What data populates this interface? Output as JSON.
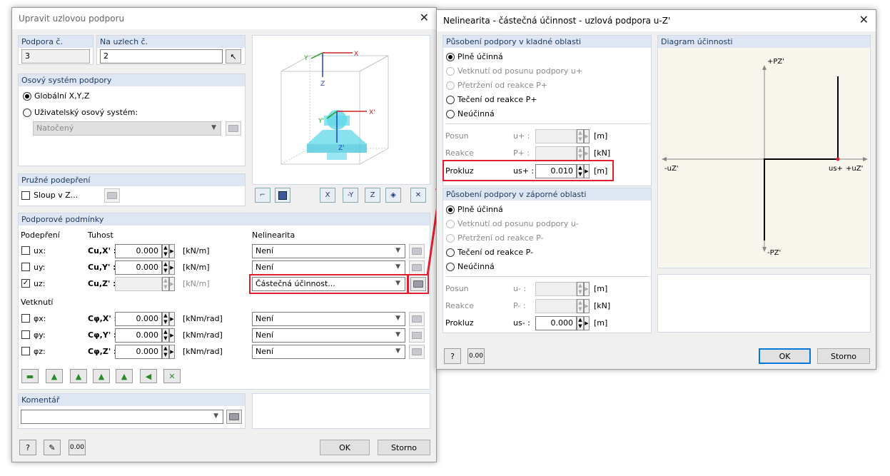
{
  "left_dialog": {
    "title": "Upravit uzlovou podporu",
    "support_no": {
      "label": "Podpora č.",
      "value": "3"
    },
    "on_nodes": {
      "label": "Na uzlech č.",
      "value": "2"
    },
    "axis_system": {
      "header": "Osový systém podpory",
      "global": "Globální X,Y,Z",
      "user": "Uživatelský osový systém:",
      "rotated": "Natočený"
    },
    "elastic": {
      "header": "Pružné podepření",
      "column": "Sloup v Z..."
    },
    "conditions": {
      "header": "Podporové podmínky",
      "col_support": "Podepření",
      "col_stiffness": "Tuhost",
      "col_nonlin": "Nelinearita",
      "rows": [
        {
          "label": "ux:",
          "sub": "Cu,X' :",
          "value": "0.000",
          "unit": "[kN/m]",
          "nonlin": "Není",
          "checked": false
        },
        {
          "label": "uy:",
          "sub": "Cu,Y' :",
          "value": "0.000",
          "unit": "[kN/m]",
          "nonlin": "Není",
          "checked": false
        },
        {
          "label": "uz:",
          "sub": "Cu,Z' :",
          "value": "",
          "unit": "[kN/m]",
          "nonlin": "Částečná účinnost...",
          "checked": true
        }
      ],
      "fix_header": "Vetknutí",
      "fix_rows": [
        {
          "label": "φx:",
          "sub": "Cφ,X' :",
          "value": "0.000",
          "unit": "[kNm/rad]",
          "nonlin": "Není"
        },
        {
          "label": "φy:",
          "sub": "Cφ,Y' :",
          "value": "0.000",
          "unit": "[kNm/rad]",
          "nonlin": "Není"
        },
        {
          "label": "φz:",
          "sub": "Cφ,Z' :",
          "value": "0.000",
          "unit": "[kNm/rad]",
          "nonlin": "Není"
        }
      ]
    },
    "comment": {
      "header": "Komentář",
      "value": ""
    },
    "ok": "OK",
    "cancel": "Storno",
    "axis_labels": {
      "x": "X",
      "y": "Y",
      "z": "Z",
      "x2": "X'",
      "y2": "Y'",
      "z2": "Z'"
    },
    "toolbar_labels": {
      "x": "X",
      "y": "Y",
      "z": "Z",
      "neg_y": "-Y"
    }
  },
  "right_dialog": {
    "title": "Nelinearita - částečná účinnost - uzlová podpora u-Z'",
    "positive": {
      "header": "Působení podpory v kladné oblasti",
      "options": [
        "Plně účinná",
        "Vetknutí od posunu podpory u+",
        "Přetržení od reakce P+",
        "Tečení od reakce P+",
        "Neúčinná"
      ],
      "posun": {
        "label": "Posun",
        "sym": "u+ :",
        "value": "",
        "unit": "[m]"
      },
      "reakce": {
        "label": "Reakce",
        "sym": "P+ :",
        "value": "",
        "unit": "[kN]"
      },
      "prokluz": {
        "label": "Prokluz",
        "sym": "us+ :",
        "value": "0.010",
        "unit": "[m]"
      }
    },
    "negative": {
      "header": "Působení podpory v záporné oblasti",
      "options": [
        "Plně účinná",
        "Vetknutí od posunu podpory u-",
        "Přetržení od reakce P-",
        "Tečení od reakce P-",
        "Neúčinná"
      ],
      "posun": {
        "label": "Posun",
        "sym": "u- :",
        "value": "",
        "unit": "[m]"
      },
      "reakce": {
        "label": "Reakce",
        "sym": "P- :",
        "value": "",
        "unit": "[kN]"
      },
      "prokluz": {
        "label": "Prokluz",
        "sym": "us- :",
        "value": "0.000",
        "unit": "[m]"
      }
    },
    "diagram": {
      "header": "Diagram účinnosti",
      "pz_pos": "+PZ'",
      "pz_neg": "-PZ'",
      "uz_neg": "-uZ'",
      "uz_pos": "+uZ'",
      "us_label": "us+"
    },
    "ok": "OK",
    "cancel": "Storno"
  },
  "colors": {
    "highlight": "#e02030",
    "group_header": "#dde6f2",
    "accent": "#0078d7"
  }
}
